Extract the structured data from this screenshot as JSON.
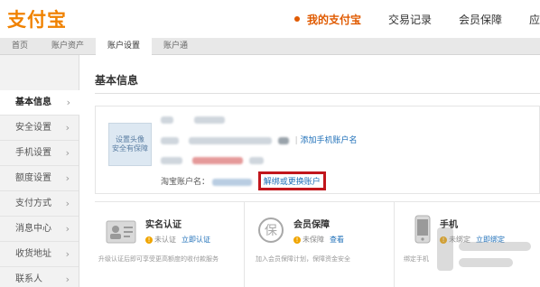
{
  "logo": {
    "text": "支付宝"
  },
  "nav": {
    "items": [
      "我的支付宝",
      "交易记录",
      "会员保障",
      "应用中"
    ]
  },
  "subnav": {
    "items": [
      "首页",
      "账户资产",
      "账户设置",
      "账户通"
    ]
  },
  "sidebar": {
    "items": [
      "基本信息",
      "安全设置",
      "手机设置",
      "额度设置",
      "支付方式",
      "消息中心",
      "收货地址",
      "联系人"
    ]
  },
  "main": {
    "title": "基本信息",
    "avatar_text": "设置头像 安全有保障",
    "add_phone_link": "添加手机账户名",
    "taobao_label": "淘宝账户名：",
    "unbind_link": "解绑或更换账户"
  },
  "cards": [
    {
      "title": "实名认证",
      "status": "未认证",
      "link": "立即认证",
      "desc": "升级认证后即可享受更高额度的收付款服务"
    },
    {
      "title": "会员保障",
      "status": "未保障",
      "link": "查看",
      "desc": "加入会员保障计划，保障资金安全"
    },
    {
      "title": "手机",
      "status": "未绑定",
      "link": "立即绑定",
      "desc": "绑定手机"
    }
  ],
  "colors": {
    "accent": "#e05a00",
    "link": "#1e6fb8",
    "highlight": "#c1161c"
  }
}
